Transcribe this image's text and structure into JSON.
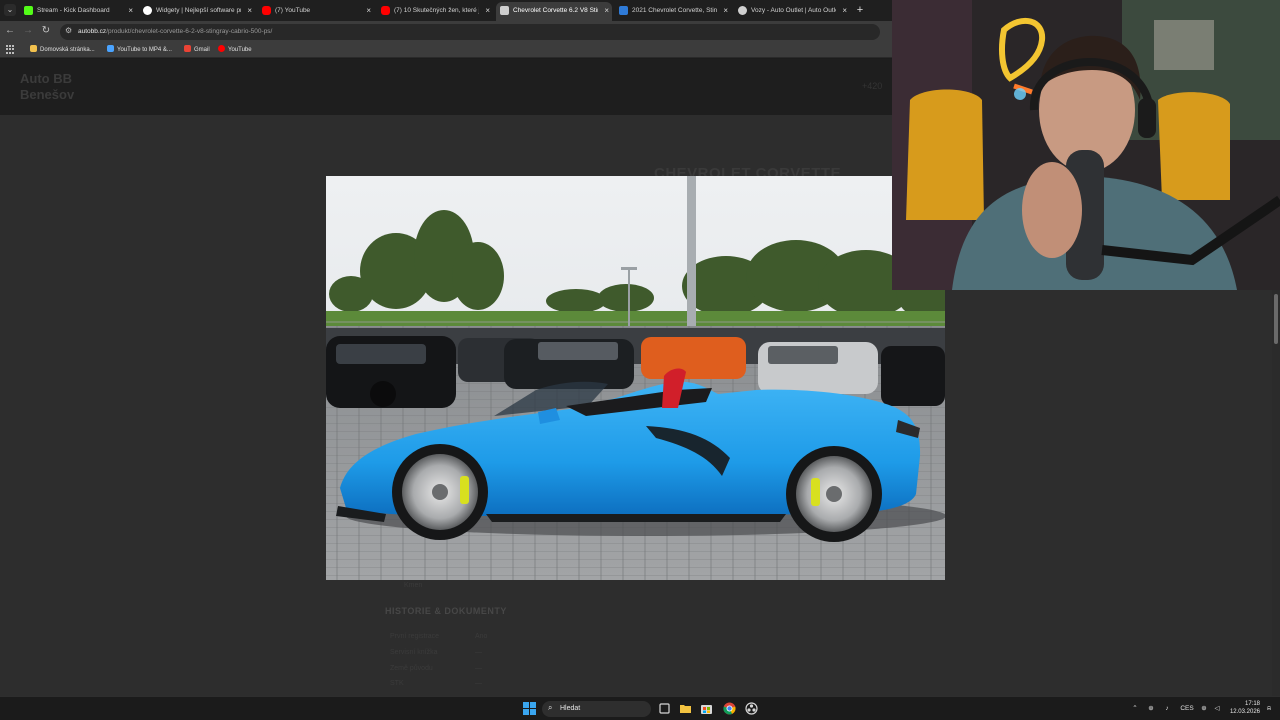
{
  "browser": {
    "tabs": [
      {
        "title": "Stream - Kick Dashboard",
        "favicon_color": "#53fc18",
        "active": false
      },
      {
        "title": "Widgety | Nejlepší software pro",
        "favicon_color": "#ffffff",
        "active": false
      },
      {
        "title": "(7) YouTube",
        "favicon_color": "#ff0000",
        "active": false
      },
      {
        "title": "(7) 10 Skutečných žen, které jsi",
        "favicon_color": "#ff0000",
        "active": false
      },
      {
        "title": "Chevrolet Corvette 6.2 V8 Sting",
        "favicon_color": "#cfcfcf",
        "active": true
      },
      {
        "title": "2021 Chevrolet Corvette, Stingr",
        "favicon_color": "#2f7bd8",
        "active": false
      },
      {
        "title": "Vozy - Auto Outlet | Auto Outle",
        "favicon_color": "#cfcfcf",
        "active": false
      }
    ],
    "close_glyph": "×",
    "new_tab_glyph": "+",
    "menu_glyph": "⌄",
    "url_domain": "autobb.cz",
    "url_path": "/produkt/chevrolet-corvette-6-2-v8-stingray-cabrio-500-ps/",
    "nav": {
      "back": "←",
      "forward": "→",
      "reload": "↻",
      "tune": "⚙"
    },
    "bookmarks": [
      {
        "label": "Domovská stránka...",
        "color": "#f2c14e"
      },
      {
        "label": "YouTube to MP4 &...",
        "color": "#4aa3ff"
      },
      {
        "label": "Gmail",
        "color": "#ea4335"
      },
      {
        "label": "YouTube",
        "color": "#ff0000"
      }
    ]
  },
  "site": {
    "logo": "Auto BB Benešov",
    "phone": "+420",
    "product_title": "CHEVROLET CORVETTE",
    "small_label": "Kmen",
    "history_heading": "HISTORIE & DOKUMENTY",
    "history_rows": [
      {
        "label": "První registrace",
        "value": "Ano"
      },
      {
        "label": "Servisní knížka",
        "value": "—"
      },
      {
        "label": "Země původu",
        "value": "—"
      },
      {
        "label": "STK",
        "value": "—"
      }
    ]
  },
  "taskbar": {
    "search_placeholder": "Hledat",
    "search_glyph": "⌕",
    "language": "CES",
    "time": "17:18",
    "date": "12.03.2026",
    "tray_glyphs": {
      "chevron": "⌃",
      "network": "⊕",
      "mic": "♪",
      "speaker": "◁",
      "notification": "⍾"
    },
    "accent": "#1f8fe6"
  }
}
